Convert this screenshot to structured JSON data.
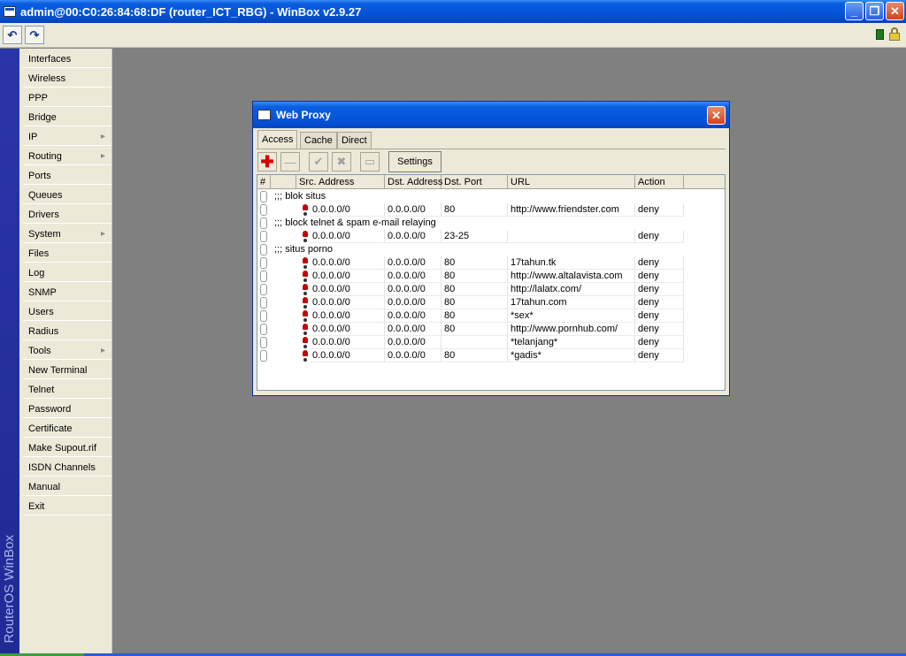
{
  "window": {
    "title": "admin@00:C0:26:84:68:DF (router_ICT_RBG) - WinBox v2.9.27",
    "minimize": "_",
    "maximize": "❐",
    "close": "✕"
  },
  "toolbar": {
    "undo": "↶",
    "redo": "↷"
  },
  "sidebar": {
    "brand": "RouterOS WinBox"
  },
  "menu": {
    "items": [
      {
        "label": "Interfaces"
      },
      {
        "label": "Wireless"
      },
      {
        "label": "PPP"
      },
      {
        "label": "Bridge"
      },
      {
        "label": "IP",
        "submenu": true
      },
      {
        "label": "Routing",
        "submenu": true
      },
      {
        "label": "Ports"
      },
      {
        "label": "Queues"
      },
      {
        "label": "Drivers"
      },
      {
        "label": "System",
        "submenu": true
      },
      {
        "label": "Files"
      },
      {
        "label": "Log"
      },
      {
        "label": "SNMP"
      },
      {
        "label": "Users"
      },
      {
        "label": "Radius"
      },
      {
        "label": "Tools",
        "submenu": true
      },
      {
        "label": "New Terminal"
      },
      {
        "label": "Telnet"
      },
      {
        "label": "Password"
      },
      {
        "label": "Certificate"
      },
      {
        "label": "Make Supout.rif"
      },
      {
        "label": "ISDN Channels"
      },
      {
        "label": "Manual"
      },
      {
        "label": "Exit"
      }
    ]
  },
  "proxy": {
    "title": "Web Proxy",
    "close": "✕",
    "tabs": [
      "Access",
      "Cache",
      "Direct"
    ],
    "active_tab": "Access",
    "buttons": {
      "add": "✚",
      "remove": "—",
      "enable": "✔",
      "disable": "✖",
      "comment": "▭",
      "settings": "Settings"
    },
    "columns": [
      "#",
      "Src. Address",
      "Dst. Address",
      "Dst. Port",
      "URL",
      "Action"
    ],
    "rows": [
      {
        "comment": ";;; blok situs"
      },
      {
        "src": "0.0.0.0/0",
        "dst": "0.0.0.0/0",
        "port": "80",
        "url": "http://www.friendster.com",
        "action": "deny"
      },
      {
        "comment": ";;; block telnet & spam e-mail relaying"
      },
      {
        "src": "0.0.0.0/0",
        "dst": "0.0.0.0/0",
        "port": "23-25",
        "url": "",
        "action": "deny"
      },
      {
        "comment": ";;; situs porno"
      },
      {
        "src": "0.0.0.0/0",
        "dst": "0.0.0.0/0",
        "port": "80",
        "url": "17tahun.tk",
        "action": "deny"
      },
      {
        "src": "0.0.0.0/0",
        "dst": "0.0.0.0/0",
        "port": "80",
        "url": "http://www.altalavista.com",
        "action": "deny"
      },
      {
        "src": "0.0.0.0/0",
        "dst": "0.0.0.0/0",
        "port": "80",
        "url": "http://lalatx.com/",
        "action": "deny"
      },
      {
        "src": "0.0.0.0/0",
        "dst": "0.0.0.0/0",
        "port": "80",
        "url": "17tahun.com",
        "action": "deny"
      },
      {
        "src": "0.0.0.0/0",
        "dst": "0.0.0.0/0",
        "port": "80",
        "url": "*sex*",
        "action": "deny"
      },
      {
        "src": "0.0.0.0/0",
        "dst": "0.0.0.0/0",
        "port": "80",
        "url": "http://www.pornhub.com/",
        "action": "deny"
      },
      {
        "src": "0.0.0.0/0",
        "dst": "0.0.0.0/0",
        "port": "",
        "url": "*telanjang*",
        "action": "deny"
      },
      {
        "src": "0.0.0.0/0",
        "dst": "0.0.0.0/0",
        "port": "80",
        "url": "*gadis*",
        "action": "deny"
      }
    ]
  }
}
